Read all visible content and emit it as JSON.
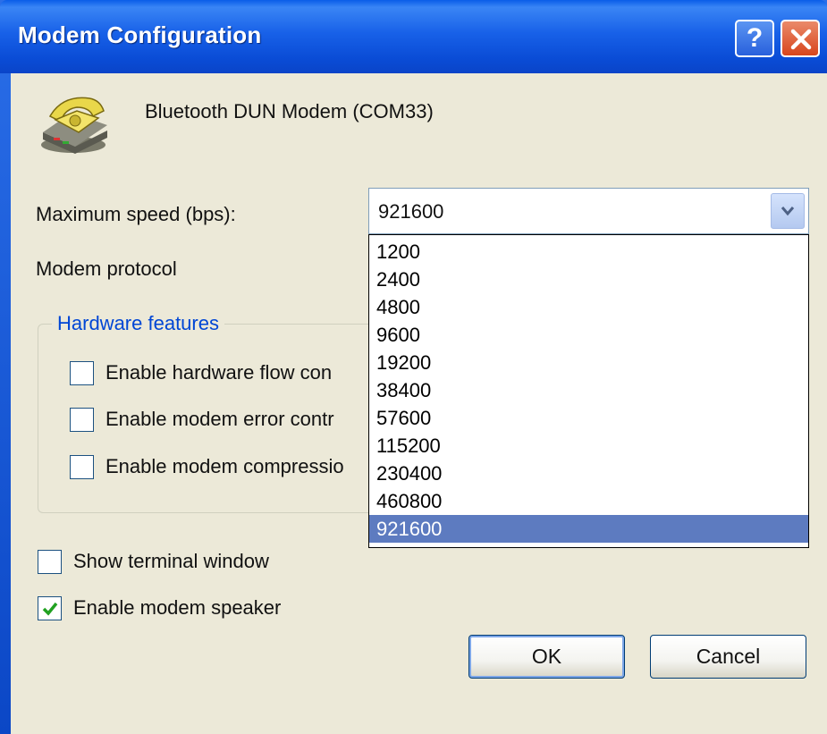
{
  "window": {
    "title": "Modem Configuration",
    "help_label": "?"
  },
  "device": {
    "name": "Bluetooth DUN Modem (COM33)",
    "icon": "telephone-modem-icon"
  },
  "speed": {
    "label": "Maximum speed (bps):",
    "selected": "921600",
    "options": [
      "1200",
      "2400",
      "4800",
      "9600",
      "19200",
      "38400",
      "57600",
      "115200",
      "230400",
      "460800",
      "921600"
    ]
  },
  "protocol": {
    "label": "Modem protocol"
  },
  "hardware": {
    "legend": "Hardware features",
    "flow_control": {
      "label": "Enable hardware flow con",
      "checked": false
    },
    "error_control": {
      "label": "Enable modem error contr",
      "checked": false
    },
    "compression": {
      "label": "Enable modem compressio",
      "checked": false
    }
  },
  "options": {
    "terminal": {
      "label": "Show terminal window",
      "checked": false
    },
    "speaker": {
      "label": "Enable modem speaker",
      "checked": true
    }
  },
  "buttons": {
    "ok": "OK",
    "cancel": "Cancel"
  },
  "colors": {
    "titlebar": "#0a4cd6",
    "selection": "#5d7bc0",
    "dialog_bg": "#ece9d8",
    "close": "#d8451c",
    "check": "#21a121"
  }
}
